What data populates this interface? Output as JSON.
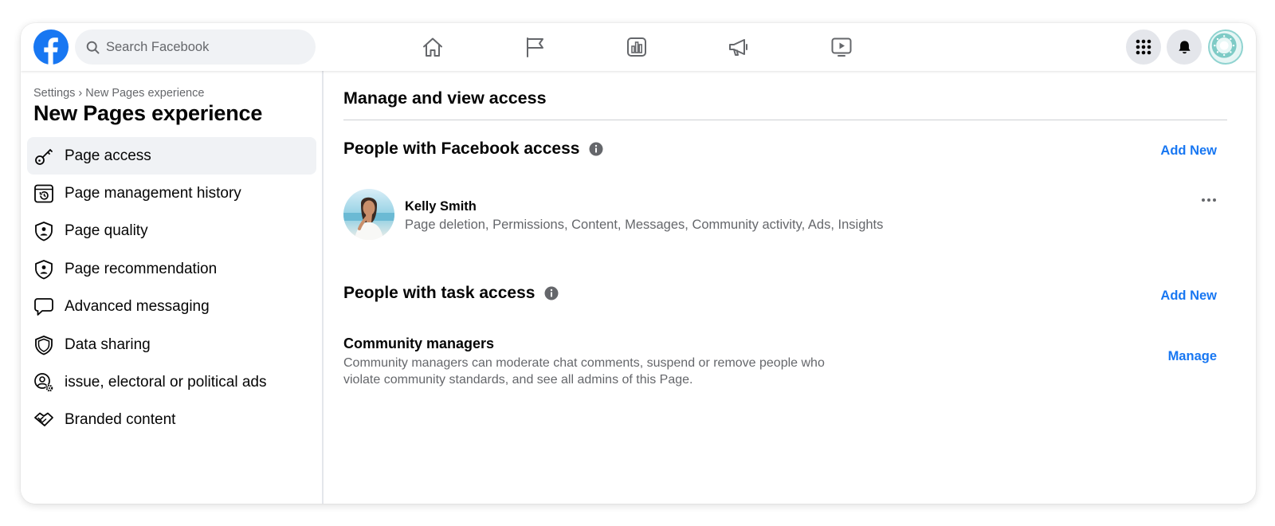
{
  "header": {
    "logo_icon": "facebook-logo",
    "search": {
      "placeholder": "Search Facebook",
      "value": ""
    },
    "nav_icons": [
      "home-icon",
      "flag-icon",
      "insights-icon",
      "megaphone-icon",
      "video-icon"
    ],
    "right_icons": [
      "menu-grid-icon",
      "notifications-bell-icon",
      "profile-avatar"
    ]
  },
  "sidebar": {
    "breadcrumb": "Settings › New Pages experience",
    "title": "New Pages experience",
    "items": [
      {
        "label": "Page access",
        "icon": "key-icon",
        "active": true
      },
      {
        "label": "Page management history",
        "icon": "history-icon",
        "active": false
      },
      {
        "label": "Page quality",
        "icon": "shield-person-icon",
        "active": false
      },
      {
        "label": "Page recommendation",
        "icon": "shield-person-icon",
        "active": false
      },
      {
        "label": "Advanced messaging",
        "icon": "speech-bubble-icon",
        "active": false
      },
      {
        "label": "Data sharing",
        "icon": "shield-icon",
        "active": false
      },
      {
        "label": "issue, electoral or political ads",
        "icon": "person-gear-icon",
        "active": false
      },
      {
        "label": "Branded content",
        "icon": "handshake-icon",
        "active": false
      }
    ]
  },
  "main": {
    "title": "Manage and view access",
    "facebook_access": {
      "title": "People with Facebook access",
      "add_label": "Add New",
      "person": {
        "name": "Kelly Smith",
        "permissions": "Page deletion, Permissions, Content, Messages, Community activity, Ads, Insights"
      }
    },
    "task_access": {
      "title": "People with task access",
      "add_label": "Add New",
      "role": {
        "name": "Community managers",
        "description": "Community managers can moderate chat comments, suspend or remove people who violate community standards, and see all admins of this Page.",
        "manage_label": "Manage"
      }
    }
  },
  "colors": {
    "brand_blue": "#1877f2",
    "active_bg": "#f0f2f5",
    "secondary_text": "#65676b"
  }
}
